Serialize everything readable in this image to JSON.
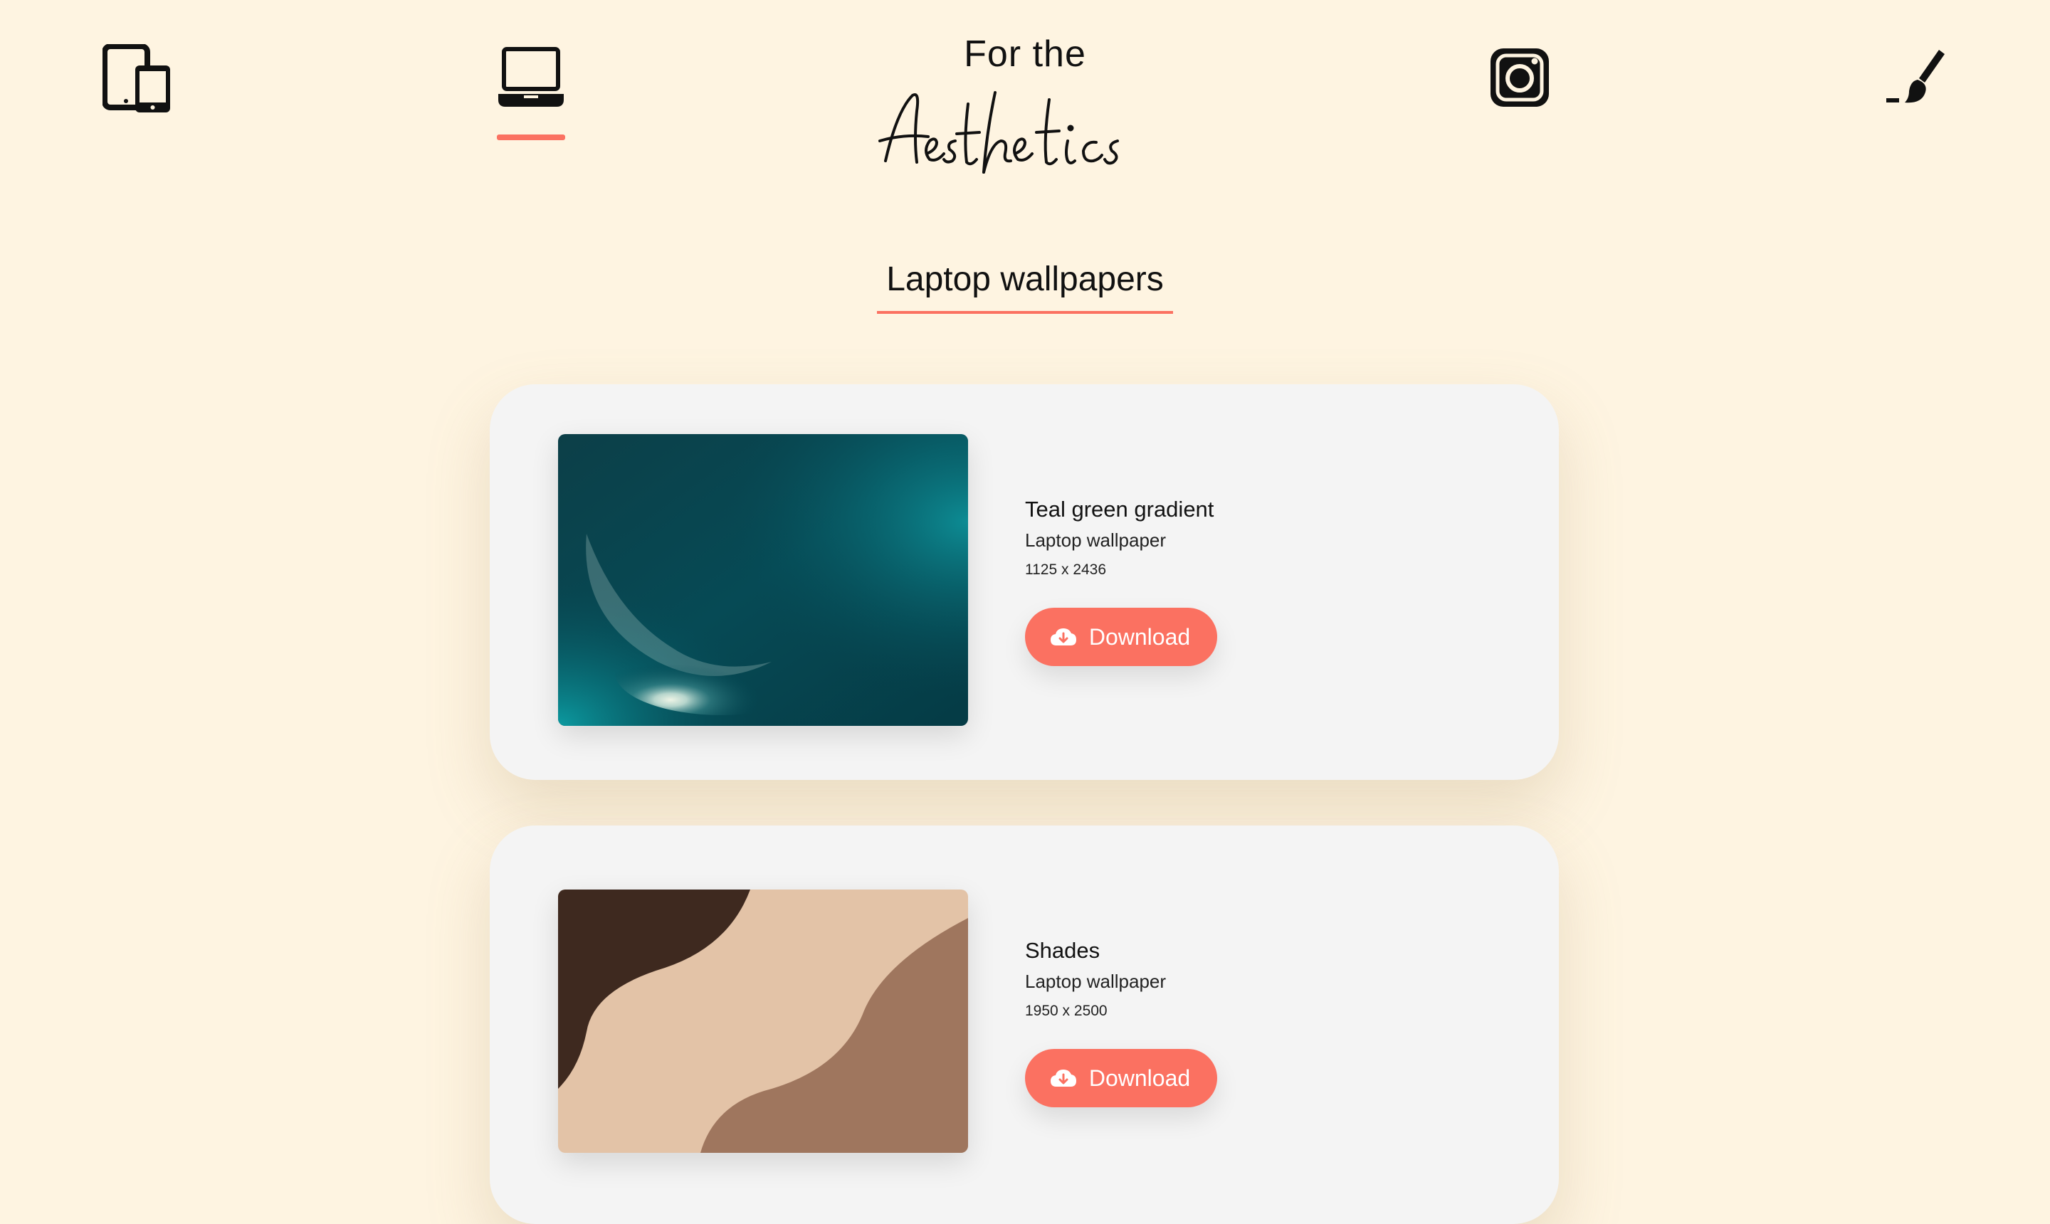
{
  "colors": {
    "background": "#fef4e1",
    "accent": "#fb7161",
    "card": "#f4f4f4"
  },
  "nav": {
    "items": [
      {
        "name": "devices",
        "icon": "devices-icon",
        "active": false
      },
      {
        "name": "laptop",
        "icon": "laptop-icon",
        "active": true
      },
      {
        "name": "instagram",
        "icon": "instagram-icon",
        "active": false
      },
      {
        "name": "brush",
        "icon": "paint-brush-icon",
        "active": false
      }
    ]
  },
  "brand": {
    "top_text": "For the",
    "script_text": "Aesthetics"
  },
  "section": {
    "title": "Laptop wallpapers"
  },
  "wallpapers": [
    {
      "title": "Teal green gradient",
      "subtitle": "Laptop wallpaper",
      "dimensions": "1125 x 2436",
      "button_label": "Download",
      "button_icon": "cloud-download-icon"
    },
    {
      "title": "Shades",
      "subtitle": "Laptop wallpaper",
      "dimensions": "1950 x 2500",
      "button_label": "Download",
      "button_icon": "cloud-download-icon"
    }
  ]
}
